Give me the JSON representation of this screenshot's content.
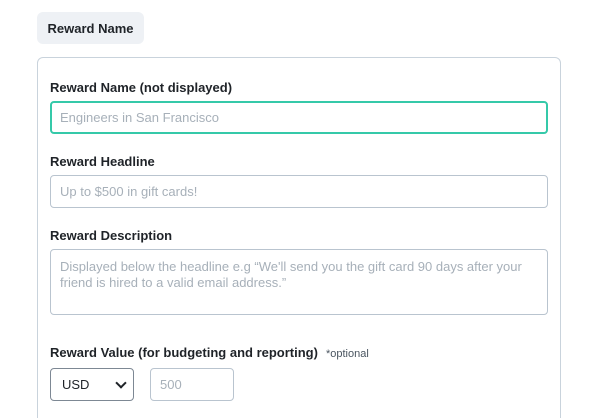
{
  "tab": {
    "label": "Reward Name"
  },
  "form": {
    "reward_name": {
      "label": "Reward Name (not displayed)",
      "placeholder": "Engineers in San Francisco",
      "value": ""
    },
    "reward_headline": {
      "label": "Reward Headline",
      "placeholder": "Up to $500 in gift cards!",
      "value": ""
    },
    "reward_description": {
      "label": "Reward Description",
      "placeholder": "Displayed below the headline e.g “We'll send you the gift card 90 days after your friend is hired to a valid email address.”",
      "value": ""
    },
    "reward_value": {
      "label": "Reward Value (for budgeting and reporting)",
      "optional_note": "*optional",
      "currency": "USD",
      "amount_placeholder": "500"
    }
  },
  "colors": {
    "focus_border": "#35c9a9",
    "field_border": "#b9c4cf",
    "tab_background": "#eef1f5"
  }
}
